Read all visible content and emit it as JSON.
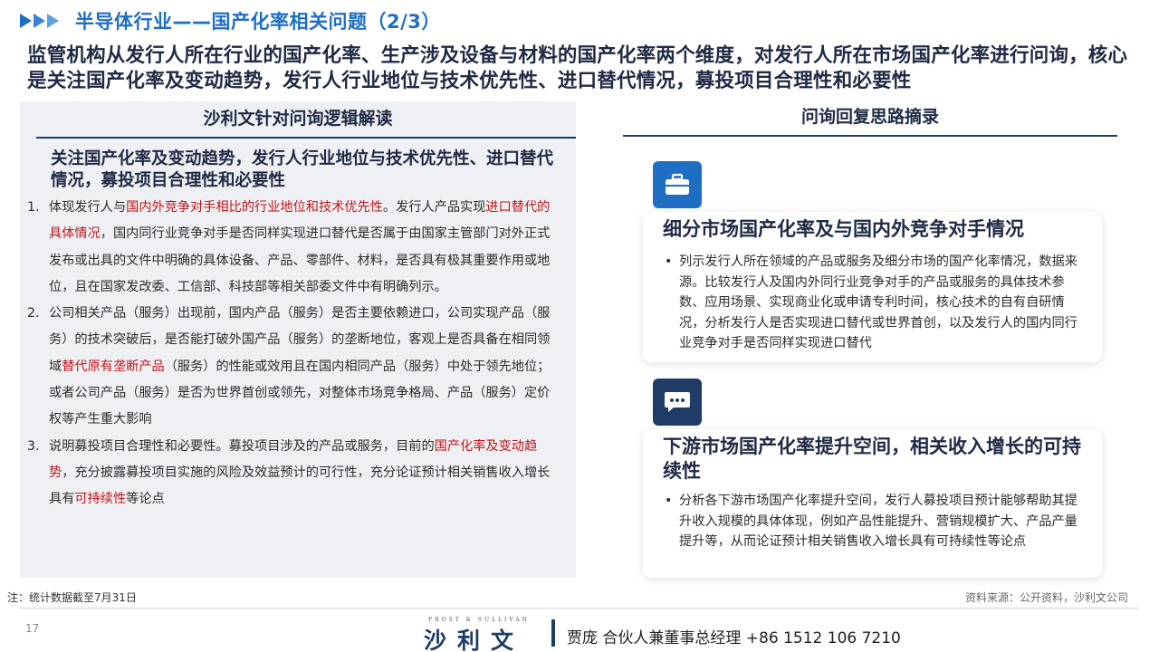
{
  "header": {
    "title": "半导体行业——国产化率相关问题（2/3）",
    "headline": "监管机构从发行人所在行业的国产化率、生产涉及设备与材料的国产化率两个维度，对发行人所在市场国产化率进行问询，核心是关注国产化率及变动趋势，发行人行业地位与技术优先性、进口替代情况，募投项目合理性和必要性"
  },
  "left": {
    "heading": "沙利文针对问询逻辑解读",
    "subheading": "关注国产化率及变动趋势，发行人行业地位与技术优先性、进口替代情况，募投项目合理性和必要性",
    "points": [
      {
        "num": "1.",
        "parts": [
          {
            "t": "体现发行人与"
          },
          {
            "t": "国内外竞争对手相比的行业地位和技术优先性",
            "red": true
          },
          {
            "t": "。发行人产品实现"
          },
          {
            "t": "进口替代的具体情况",
            "red": true
          },
          {
            "t": "，国内同行业竞争对手是否同样实现进口替代是否属于由国家主管部门对外正式发布或出具的文件中明确的具体设备、产品、零部件、材料，是否具有极其重要作用或地位，且在国家发改委、工信部、科技部等相关部委文件中有明确列示。"
          }
        ]
      },
      {
        "num": "2.",
        "parts": [
          {
            "t": "公司相关产品（服务）出现前，国内产品（服务）是否主要依赖进口，公司实现产品（服务）的技术突破后，是否能打破外国产品（服务）的垄断地位，客观上是否具备在相同领域"
          },
          {
            "t": "替代原有垄断产品",
            "red": true
          },
          {
            "t": "（服务）的性能或效用且在国内相同产品（服务）中处于领先地位；或者公司产品（服务）是否为世界首创或领先，对整体市场竞争格局、产品（服务）定价权等产生重大影响"
          }
        ]
      },
      {
        "num": "3.",
        "parts": [
          {
            "t": "说明募投项目合理性和必要性。募投项目涉及的产品或服务，目前的"
          },
          {
            "t": "国产化率及变动趋势",
            "red": true
          },
          {
            "t": "，充分披露募投项目实施的风险及效益预计的可行性，充分论证预计相关销售收入增长具有"
          },
          {
            "t": "可持续性",
            "red": true
          },
          {
            "t": "等论点"
          }
        ]
      }
    ]
  },
  "right": {
    "heading": "问询回复思路摘录",
    "cards": [
      {
        "icon": "briefcase-icon",
        "title": "细分市场国产化率及与国内外竞争对手情况",
        "bullet": "•",
        "body": "列示发行人所在领域的产品或服务及细分市场的国产化率情况，数据来源。比较发行人及国内外同行业竞争对手的产品或服务的具体技术参数、应用场景、实现商业化或申请专利时间，核心技术的自有自研情况，分析发行人是否实现进口替代或世界首创，以及发行人的国内同行业竞争对手是否同样实现进口替代"
      },
      {
        "icon": "chat-bubble-icon",
        "title": "下游市场国产化率提升空间，相关收入增长的可持续性",
        "bullet": "•",
        "body": "分析各下游市场国产化率提升空间，发行人募投项目预计能够帮助其提升收入规模的具体体现，例如产品性能提升、营销规模扩大、产品产量提升等，从而论证预计相关销售收入增长具有可持续性等论点"
      }
    ]
  },
  "footer": {
    "note": "注：统计数据截至7月31日",
    "source": "资料来源：公开资料，沙利文公司",
    "page": "17",
    "brand_small": "FROST & SULLIVAN",
    "brand": "沙利文",
    "contact": "贾庞  合伙人兼董事总经理   +86 1512 106 7210"
  },
  "colors": {
    "accent_blue": "#1e6fc4",
    "navy": "#1f3c66",
    "highlight_red": "#c0161c",
    "panel_gray": "#eef0f3"
  }
}
